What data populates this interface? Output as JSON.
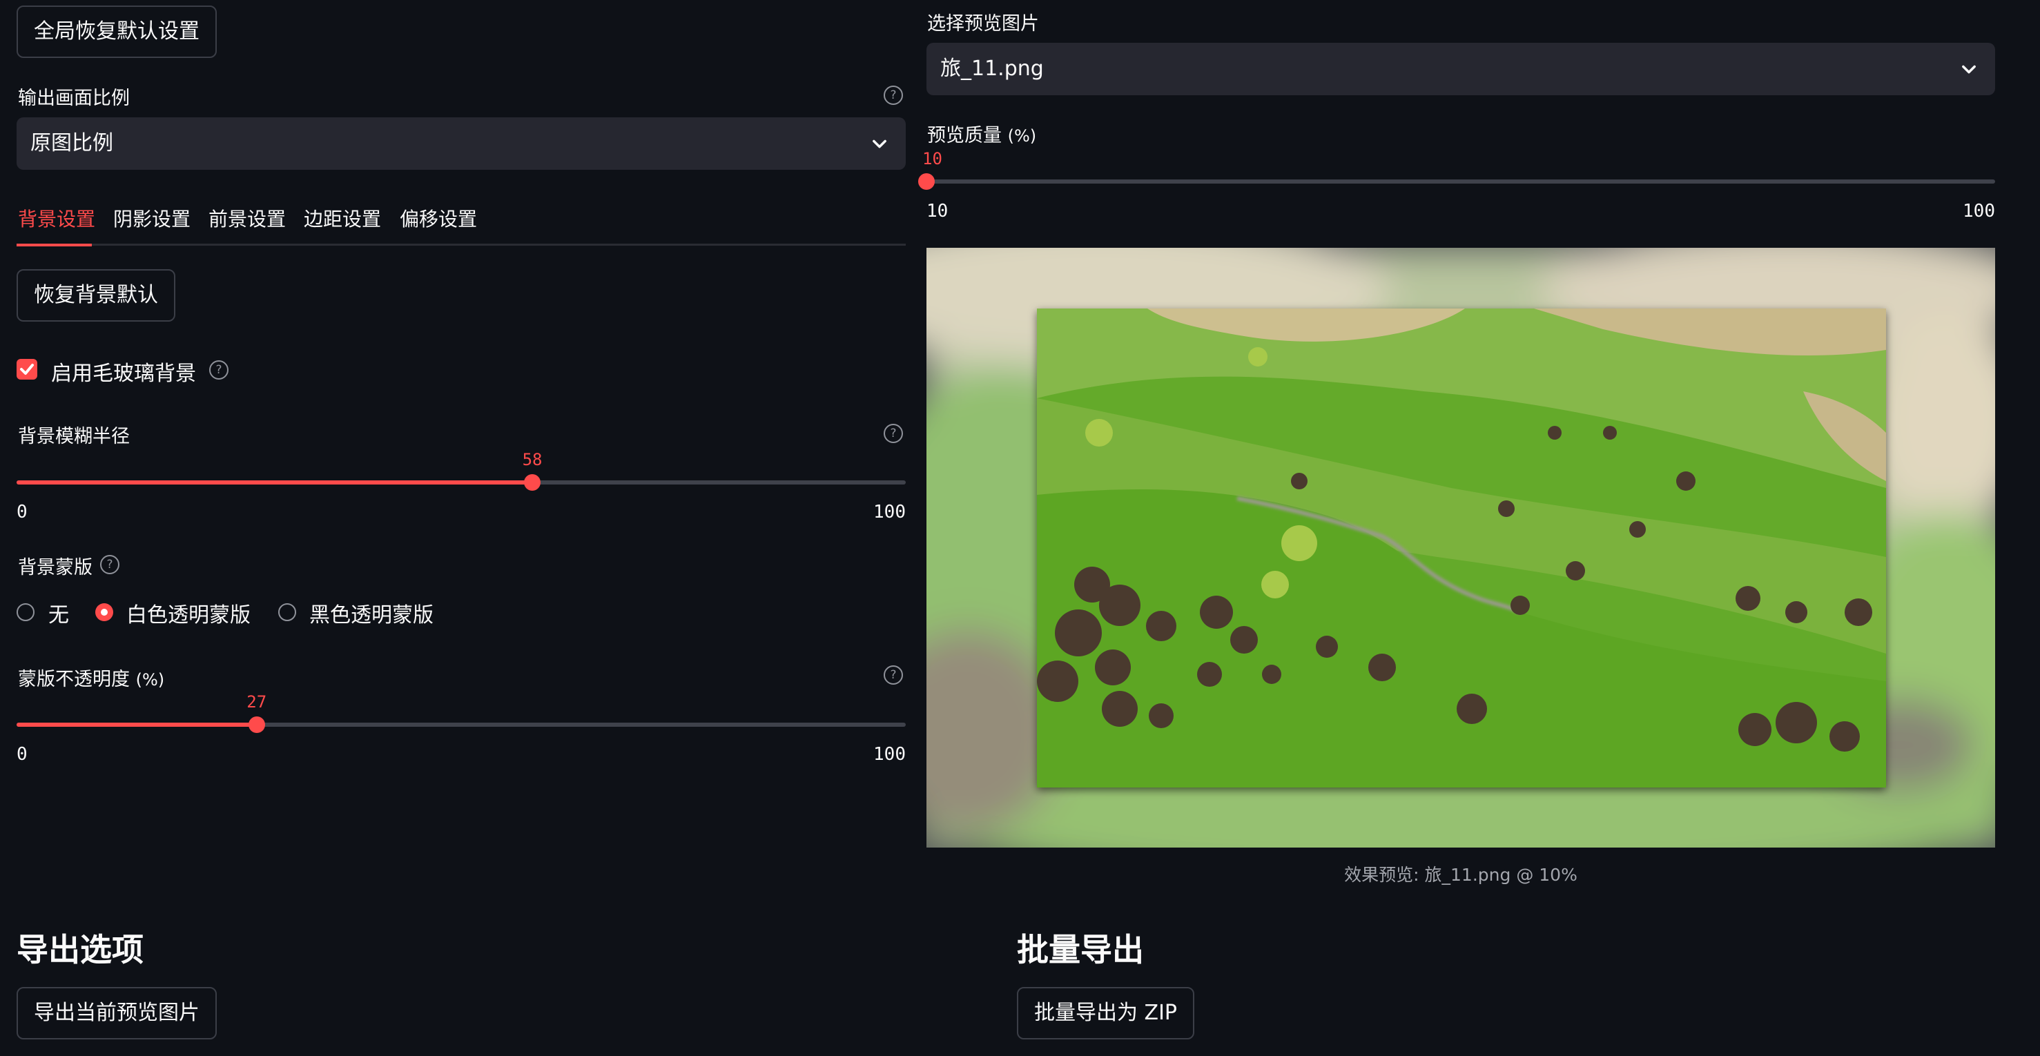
{
  "left": {
    "reset_all_button": "全局恢复默认设置",
    "aspect": {
      "label": "输出画面比例",
      "value": "原图比例"
    },
    "tabs": [
      "背景设置",
      "阴影设置",
      "前景设置",
      "边距设置",
      "偏移设置"
    ],
    "active_tab": 0,
    "reset_bg_button": "恢复背景默认",
    "frosted": {
      "label": "启用毛玻璃背景",
      "checked": true
    },
    "blur": {
      "label": "背景模糊半径",
      "value": 58,
      "min": 0,
      "max": 100,
      "value_text": "58",
      "min_text": "0",
      "max_text": "100"
    },
    "mask": {
      "label": "背景蒙版",
      "options": [
        "无",
        "白色透明蒙版",
        "黑色透明蒙版"
      ],
      "selected": 1
    },
    "opacity": {
      "label": "蒙版不透明度",
      "unit": "(%)",
      "value": 27,
      "min": 0,
      "max": 100,
      "value_text": "27",
      "min_text": "0",
      "max_text": "100"
    }
  },
  "right": {
    "preview_select": {
      "label": "选择预览图片",
      "value": "旅_11.png"
    },
    "quality": {
      "label": "预览质量",
      "unit": "(%)",
      "value": 10,
      "min": 10,
      "max": 100,
      "value_text": "10",
      "min_text": "10",
      "max_text": "100"
    },
    "caption": "效果预览: 旅_11.png @ 10%"
  },
  "export": {
    "title": "导出选项",
    "button": "导出当前预览图片"
  },
  "batch": {
    "title": "批量导出",
    "button": "批量导出为 ZIP"
  },
  "colors": {
    "accent": "#ff4b4b",
    "background": "#0e1117",
    "input_bg": "#262730"
  }
}
